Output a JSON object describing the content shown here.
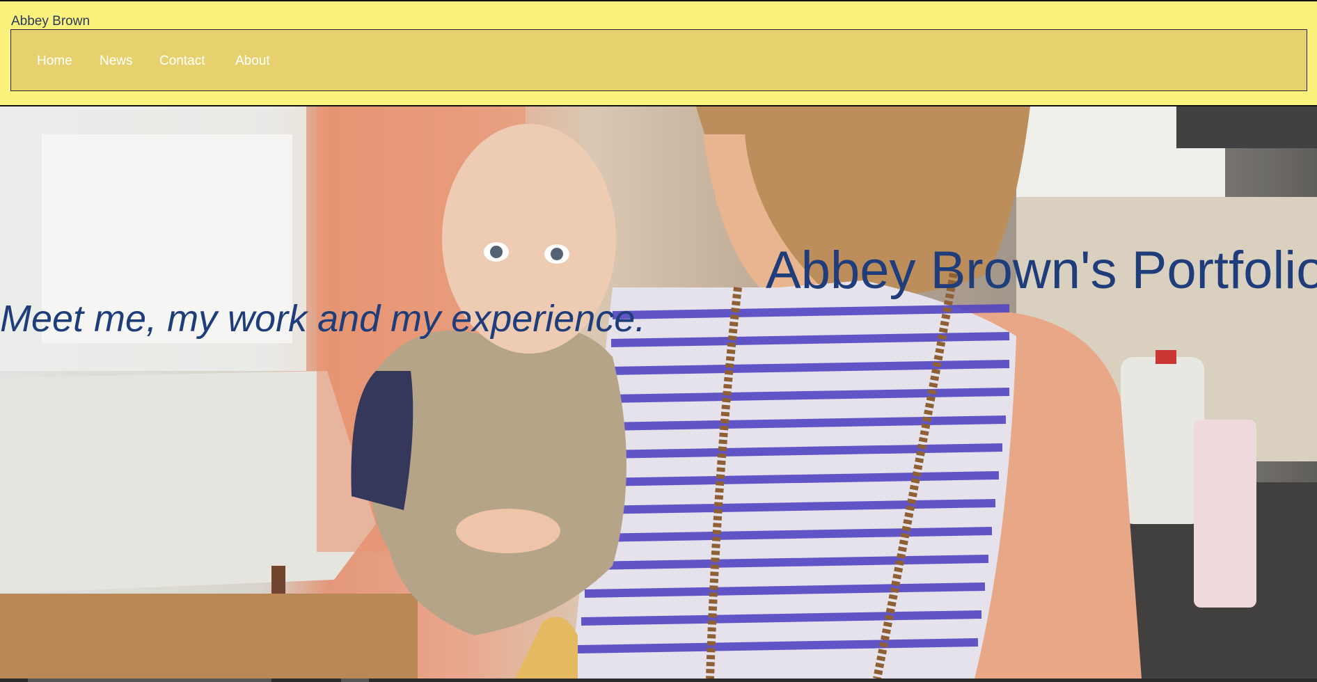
{
  "site": {
    "title": "Abbey Brown"
  },
  "nav": {
    "items": [
      {
        "label": "Home"
      },
      {
        "label": "News"
      },
      {
        "label": "Contact"
      },
      {
        "label": "About"
      }
    ]
  },
  "hero": {
    "title": "Abbey Brown's Portfolio",
    "tagline": "Meet me, my work and my experience."
  },
  "colors": {
    "header_bg": "#fbf27d",
    "nav_bg": "#e6d16e",
    "nav_text": "#ffffff",
    "hero_text": "#1f3d7a"
  }
}
